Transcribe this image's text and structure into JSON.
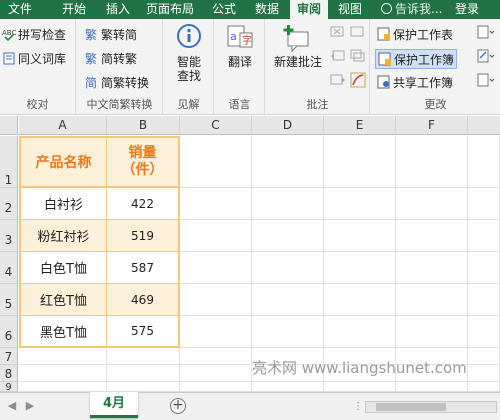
{
  "tabs": [
    "文件",
    "开始",
    "插入",
    "页面布局",
    "公式",
    "数据",
    "审阅",
    "视图"
  ],
  "active_tab": "审阅",
  "tell_me": "告诉我...",
  "login": "登录",
  "ribbon": {
    "proofing": {
      "spell": "拼写检查",
      "thesaurus": "同义词库",
      "label": "校对"
    },
    "chinese": {
      "trad": "繁转简",
      "simp": "简转繁",
      "convert": "简繁转换",
      "label": "中文简繁转换"
    },
    "insights": {
      "smart": "智能\n查找",
      "label": "见解"
    },
    "language": {
      "translate": "翻译",
      "label": "语言"
    },
    "comments": {
      "new": "新建批注",
      "label": "批注"
    },
    "changes": {
      "protect_sheet": "保护工作表",
      "protect_book": "保护工作簿",
      "share_book": "共享工作簿",
      "label": "更改"
    }
  },
  "columns": [
    "A",
    "B",
    "C",
    "D",
    "E",
    "F"
  ],
  "rows": [
    "1",
    "2",
    "3",
    "4",
    "5",
    "6",
    "7",
    "8",
    "9"
  ],
  "table": {
    "headers": [
      "产品名称",
      "销量\n（件）"
    ],
    "rows": [
      [
        "白衬衫",
        "422"
      ],
      [
        "粉红衬衫",
        "519"
      ],
      [
        "白色T恤",
        "587"
      ],
      [
        "红色T恤",
        "469"
      ],
      [
        "黑色T恤",
        "575"
      ]
    ]
  },
  "sheet": {
    "name": "4月"
  },
  "watermark": "亮术网 www.liangshunet.com",
  "colors": {
    "excel_green": "#217346",
    "header_text": "#e87a1f",
    "band": "#fdf0d8"
  }
}
